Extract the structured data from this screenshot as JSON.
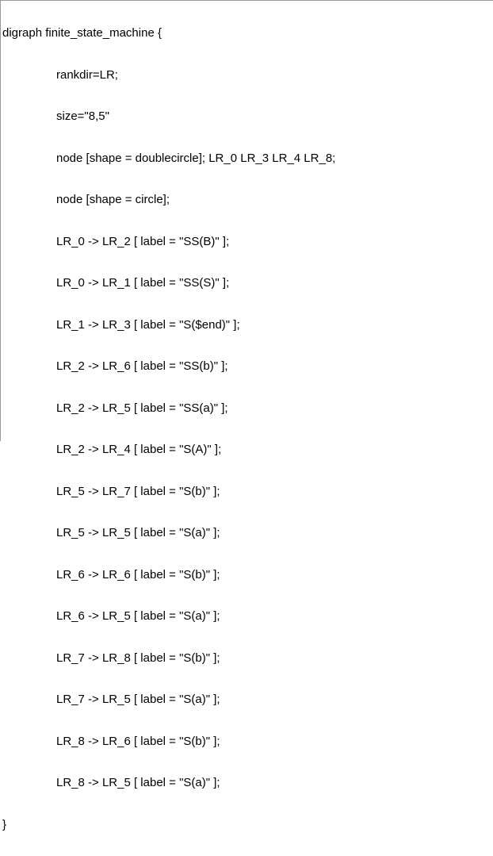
{
  "code": {
    "header": "digraph finite_state_machine {",
    "rankdir": "rankdir=LR;",
    "size": "size=\"8,5\"",
    "node_double": "node [shape = doublecircle]; LR_0 LR_3 LR_4 LR_8;",
    "node_circle": "node [shape = circle];",
    "edges": [
      "LR_0 -> LR_2 [ label = \"SS(B)\" ];",
      "LR_0 -> LR_1 [ label = \"SS(S)\" ];",
      "LR_1 -> LR_3 [ label = \"S($end)\" ];",
      "LR_2 -> LR_6 [ label = \"SS(b)\" ];",
      "LR_2 -> LR_5 [ label = \"SS(a)\" ];",
      "LR_2 -> LR_4 [ label = \"S(A)\" ];",
      "LR_5 -> LR_7 [ label = \"S(b)\" ];",
      "LR_5 -> LR_5 [ label = \"S(a)\" ];",
      "LR_6 -> LR_6 [ label = \"S(b)\" ];",
      "LR_6 -> LR_5 [ label = \"S(a)\" ];",
      "LR_7 -> LR_8 [ label = \"S(b)\" ];",
      "LR_7 -> LR_5 [ label = \"S(a)\" ];",
      "LR_8 -> LR_6 [ label = \"S(b)\" ];",
      "LR_8 -> LR_5 [ label = \"S(a)\" ];"
    ],
    "footer": "}"
  }
}
